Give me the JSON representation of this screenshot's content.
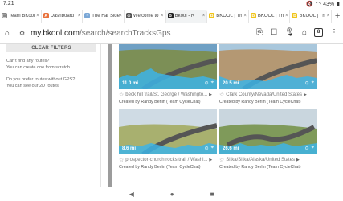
{
  "status": {
    "time": "7:21",
    "battery": "43%"
  },
  "tabs": [
    {
      "label": "Team BKool",
      "fav_color": "#888888",
      "fav_glyph": "▢"
    },
    {
      "label": "Dashboard",
      "fav_color": "#e8713b",
      "fav_glyph": "A"
    },
    {
      "label": "The Far Side",
      "fav_color": "#7aa7d6",
      "fav_glyph": "~"
    },
    {
      "label": "Welcome to",
      "fav_color": "#555555",
      "fav_glyph": "◇"
    },
    {
      "label": "Bkool - R",
      "fav_color": "#222222",
      "fav_glyph": "B"
    },
    {
      "label": "BKOOL | Th",
      "fav_color": "#f0c419",
      "fav_glyph": "B"
    },
    {
      "label": "BKOOL | Th",
      "fav_color": "#f0c419",
      "fav_glyph": "B"
    },
    {
      "label": "BKOOL | Th",
      "fav_color": "#f0c419",
      "fav_glyph": "B"
    }
  ],
  "urlbar": {
    "url_host": "my.bkool.com",
    "url_path": "/search/searchTracksGps",
    "tab_count": "8"
  },
  "sidebar": {
    "clear_filters": "CLEAR FILTERS",
    "q1": "Can't find any routes?",
    "q1_action": "You can create one from scratch.",
    "q2": "Do you prefer routes without GPS?",
    "q2_action": "You can see our 2D routes."
  },
  "cards": [
    {
      "distance": "11.0 mi",
      "title": "beck hill trail/St. George / Washingto...",
      "creator": "Created by Randy Berlin (Team CycleChat)",
      "scene": "#6fa0c4",
      "ground": "#7c8f56",
      "profile": "#3db4e6"
    },
    {
      "distance": "20.5 mi",
      "title": "Clark County/Nevada/United States",
      "creator": "Created by Randy Berlin (Team CycleChat)",
      "scene": "#a9c7dc",
      "ground": "#b49873",
      "profile": "#3db4e6"
    },
    {
      "distance": "8.6 mi",
      "title": "prospector-church rocks trail / Washi...",
      "creator": "Created by Randy Berlin (Team CycleChat)",
      "scene": "#cfdbe4",
      "ground": "#a8b06f",
      "profile": "#3db4e6"
    },
    {
      "distance": "26.6 mi",
      "title": "Sitka/Sitka/Alaska/United States",
      "creator": "Created by Randy Berlin (Team CycleChat)",
      "scene": "#c9d6de",
      "ground": "#7f9a5a",
      "profile": "#3db4e6"
    }
  ],
  "nav": {
    "back": "◀",
    "home": "●",
    "recents": "■"
  }
}
